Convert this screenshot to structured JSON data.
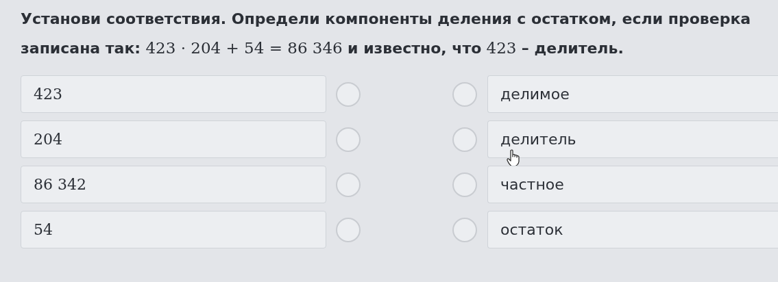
{
  "question": "**Установи соответствия. Определи компоненты деления с остатком, если проверка записана так:** 423 · 204 + 54 = 86 346 **и известно, что** 423 **– делитель.**",
  "left_items": [
    {
      "text": "423"
    },
    {
      "text": "204"
    },
    {
      "text": "86 342"
    },
    {
      "text": "54"
    }
  ],
  "right_items": [
    {
      "text": "делимое"
    },
    {
      "text": "делитель",
      "hovered": true
    },
    {
      "text": "частное"
    },
    {
      "text": "остаток"
    }
  ]
}
